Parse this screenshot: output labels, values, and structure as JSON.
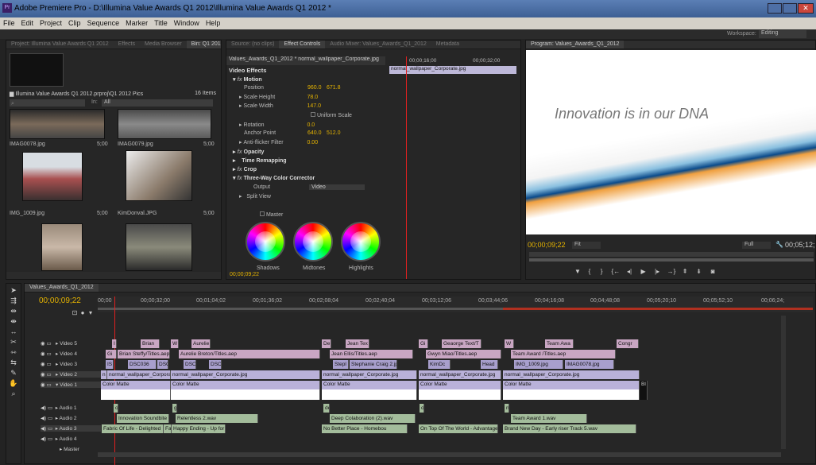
{
  "window": {
    "title": "Adobe Premiere Pro - D:\\Illumina Value Awards Q1 2012\\Illumina Value Awards Q1 2012 *",
    "app_icon": "Pr"
  },
  "menu": [
    "File",
    "Edit",
    "Project",
    "Clip",
    "Sequence",
    "Marker",
    "Title",
    "Window",
    "Help"
  ],
  "workspace": {
    "label": "Workspace:",
    "value": "Editing"
  },
  "project_panel": {
    "tabs": [
      "Project: Illumina Value Awards Q1 2012",
      "Effects",
      "Media Browser",
      "Bin: Q1 2012 P"
    ],
    "path": "Illumina Value Awards Q1 2012.prproj\\Q1 2012 Pics",
    "count": "16 Items",
    "in_label": "In:",
    "in_value": "All",
    "items": [
      {
        "name": "IMAG0078.jpg",
        "dur": "5;00"
      },
      {
        "name": "IMAG0079.jpg",
        "dur": "5;00"
      },
      {
        "name": "IMG_1009.jpg",
        "dur": "5;00"
      },
      {
        "name": "KimDonval.JPG",
        "dur": "5;00"
      }
    ]
  },
  "effect_controls": {
    "tabs": [
      "Source: (no clips)",
      "Effect Controls",
      "Audio Mixer: Values_Awards_Q1_2012",
      "Metadata"
    ],
    "clip_title": "Values_Awards_Q1_2012 * normal_wallpaper_Corporate.jpg",
    "tc_left": "00;00;16;00",
    "tc_right": "00;00;32;00",
    "mini_clip": "normal_wallpaper_Corporate.jpg",
    "section": "Video Effects",
    "rows": [
      {
        "label": "Motion",
        "v1": "",
        "v2": ""
      },
      {
        "label": "Position",
        "v1": "960.0",
        "v2": "671.8"
      },
      {
        "label": "Scale Height",
        "v1": "78.0",
        "v2": ""
      },
      {
        "label": "Scale Width",
        "v1": "147.0",
        "v2": ""
      },
      {
        "label": "Uniform Scale",
        "v1": "",
        "v2": ""
      },
      {
        "label": "Rotation",
        "v1": "0.0",
        "v2": ""
      },
      {
        "label": "Anchor Point",
        "v1": "640.0",
        "v2": "512.0"
      },
      {
        "label": "Anti-flicker Filter",
        "v1": "0.00",
        "v2": ""
      },
      {
        "label": "Opacity",
        "v1": "",
        "v2": ""
      },
      {
        "label": "Time Remapping",
        "v1": "",
        "v2": ""
      },
      {
        "label": "Crop",
        "v1": "",
        "v2": ""
      },
      {
        "label": "Three-Way Color Corrector",
        "v1": "",
        "v2": ""
      },
      {
        "label": "Output",
        "v1": "Video",
        "v2": ""
      },
      {
        "label": "Split View",
        "v1": "",
        "v2": ""
      }
    ],
    "master": "Master",
    "wheels": [
      "Shadows",
      "Midtones",
      "Highlights"
    ],
    "timecode": "00;00;09;22"
  },
  "program": {
    "tab": "Program: Values_Awards_Q1_2012",
    "slide_text": "Innovation is in our DNA",
    "timecode": "00;00;09;22",
    "fit": "Fit",
    "quality": "Full",
    "duration": "00;05;12;"
  },
  "timeline": {
    "tab": "Values_Awards_Q1_2012",
    "timecode": "00;00;09;22",
    "ruler": [
      "00;00",
      "00;00;32;00",
      "00;01;04;02",
      "00;01;36;02",
      "00;02;08;04",
      "00;02;40;04",
      "00;03;12;06",
      "00;03;44;06",
      "00;04;16;08",
      "00;04;48;08",
      "00;05;20;10",
      "00;05;52;10",
      "00;06;24;"
    ],
    "tracks": [
      "Video 5",
      "Video 4",
      "Video 3",
      "Video 2",
      "Video 1",
      "Audio 1",
      "Audio 2",
      "Audio 3",
      "Audio 4",
      "Master"
    ],
    "clips": {
      "v5": [
        "I",
        "Brian",
        "W",
        "Aurelie",
        "De",
        "Jean Tex",
        "Gi",
        "Geaorge Text/T",
        "W",
        "Team Awa",
        "Congr"
      ],
      "v4": [
        "Gi",
        "Brian Steffy/Titles.aep",
        "Aurelie Breton/Titles.aep",
        "Jean Ellis/Titles.aep",
        "Gwyn Miao/Titles.aep",
        "Team Award /Titles.aep"
      ],
      "v3": [
        "IS",
        "DSC036",
        "DSC",
        "DSC",
        "DSC",
        "Stepl",
        "Stephanie Craig 2.jpg",
        "KimDc",
        "Head",
        "IMG_1009.jpg",
        "IMAG0078.jpg"
      ],
      "v2": [
        "n",
        "normal_wallpaper_Corporat",
        "normal_wallpaper_Corporate.jpg",
        "normal_wallpaper_Corporate.jpg",
        "normal_wallpaper_Corporate.jpg",
        "normal_wallpaper_Corporate.jpg"
      ],
      "v1": [
        "Color Matte",
        "Color Matte",
        "Color Matte",
        "Color Matte",
        "Color Matte",
        "Bl"
      ],
      "a1": [
        "o",
        "g",
        "de",
        "o",
        "n"
      ],
      "a2": [
        "Innovation Soundbite (",
        "Relentless 2.wav",
        "Deep Colaboration (2).wav",
        "Team Award 1.wav"
      ],
      "a3": [
        "Fabric Of Life - Delighted",
        "Fa",
        "Happy Ending - Up for",
        "No Better Place - Homebou",
        "On Top Of The World - Advantage",
        "Brand New Day - Early riser Track 5.wav"
      ]
    }
  },
  "colors": {
    "accent": "#e6b400",
    "playhead": "#e02020",
    "video_pink": "#c9a6c3",
    "video_purple": "#a89fcd",
    "audio_green": "#a3bc9b"
  }
}
